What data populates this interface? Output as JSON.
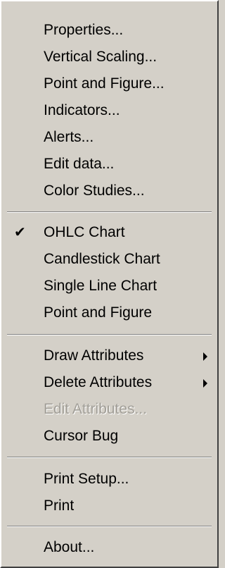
{
  "menu": {
    "properties": "Properties...",
    "vertical_scaling": "Vertical Scaling...",
    "point_and_figure_settings": "Point and Figure...",
    "indicators": "Indicators...",
    "alerts": "Alerts...",
    "edit_data": "Edit data...",
    "color_studies": "Color Studies...",
    "ohlc_chart": "OHLC Chart",
    "ohlc_chart_check": "✔",
    "candlestick_chart": "Candlestick Chart",
    "single_line_chart": "Single Line Chart",
    "point_and_figure": "Point and Figure",
    "draw_attributes": "Draw Attributes",
    "delete_attributes": "Delete Attributes",
    "edit_attributes": "Edit Attributes...",
    "cursor_bug": "Cursor Bug",
    "print_setup": "Print Setup...",
    "print": "Print",
    "about": "About..."
  },
  "colors": {
    "menu_bg": "#d4d0c8",
    "text": "#000000",
    "disabled_text": "#a19e97",
    "separator_dark": "#808080",
    "separator_light": "#ffffff"
  },
  "icons": {
    "checked": "checkmark-icon",
    "submenu": "submenu-arrow-icon"
  }
}
